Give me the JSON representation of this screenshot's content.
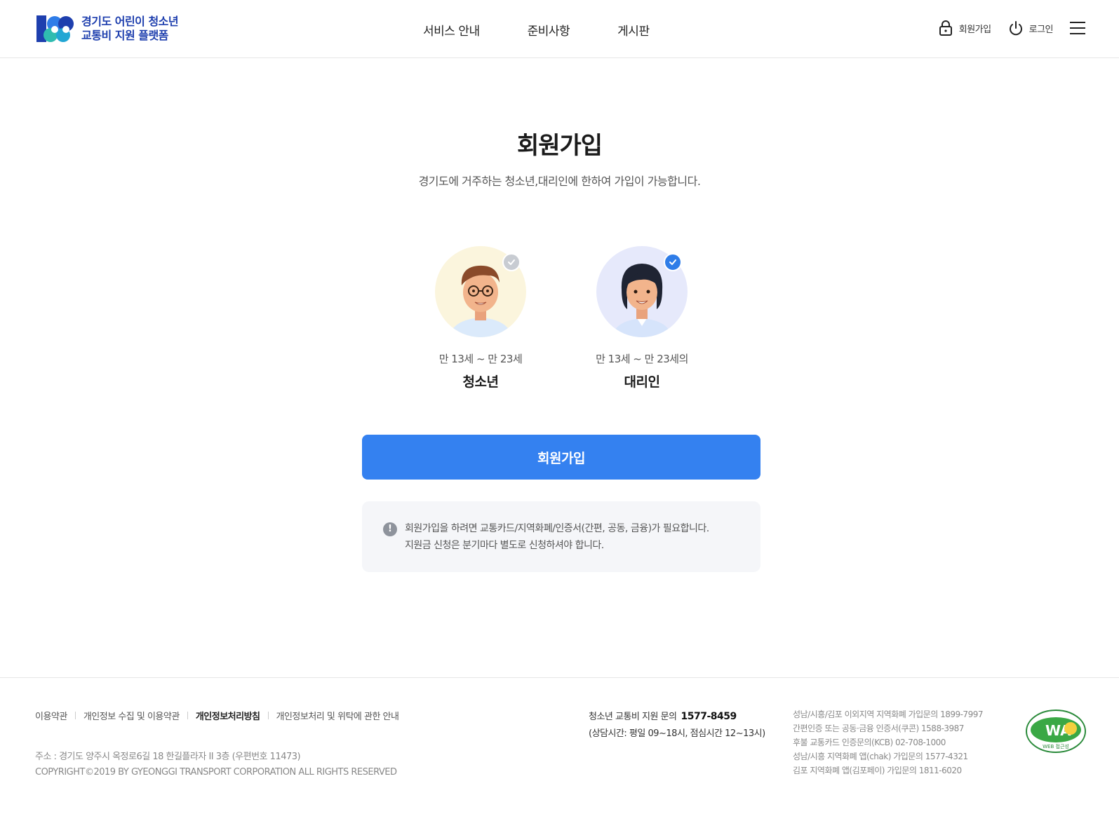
{
  "header": {
    "logo_line1": "경기도 어린이 청소년",
    "logo_line2": "교통비 지원 플랫폼",
    "nav": [
      "서비스 안내",
      "준비사항",
      "게시판"
    ],
    "signup_label": "회원가입",
    "login_label": "로그인"
  },
  "main": {
    "title": "회원가입",
    "subtitle": "경기도에 거주하는 청소년,대리인에 한하여 가입이 가능합니다.",
    "cards": [
      {
        "age": "만 13세 ~ 만 23세",
        "label": "청소년",
        "selected": false
      },
      {
        "age": "만 13세 ~ 만 23세의",
        "label": "대리인",
        "selected": true
      }
    ],
    "join_button": "회원가입",
    "notice_icon": "!",
    "notice_line1": "회원가입을 하려면 교통카드/지역화폐/인증서(간편, 공동, 금융)가 필요합니다.",
    "notice_line2": "지원금 신청은 분기마다 별도로 신청하셔야 합니다."
  },
  "footer": {
    "links": [
      "이용약관",
      "개인정보 수집 및 이용약관",
      "개인정보처리방침",
      "개인정보처리 및 위탁에 관한 안내"
    ],
    "address": "주소 : 경기도 양주시 옥정로6길 18 한길플라자 II 3층 (우편번호 11473)",
    "copyright": "COPYRIGHT©2019 BY GYEONGGI TRANSPORT CORPORATION ALL RIGHTS RESERVED",
    "cs_label": "청소년 교통비 지원 문의",
    "cs_phone": "1577-8459",
    "cs_hours": "(상담시간: 평일 09~18시, 점심시간 12~13시)",
    "info": [
      "성남/시흥/김포 이외지역 지역화폐 가입문의  1899-7997",
      "간편인증 또는 공동·금융 인증서(쿠콘)  1588-3987",
      "후불 교통카드 인증문의(KCB)  02-708-1000",
      "성남/시흥 지역화폐 앱(chak) 가입문의  1577-4321",
      "김포 지역화폐 앱(김포페이) 가입문의  1811-6020"
    ],
    "wa_mark_text": "WA",
    "wa_mark_sub": "WEB 접근성"
  },
  "colors": {
    "primary": "#3481f0",
    "logo_blue": "#1e3fae",
    "notice_bg": "#f5f6f9",
    "youth_bg": "#fbf5dd",
    "proxy_bg": "#e6e9fb"
  }
}
